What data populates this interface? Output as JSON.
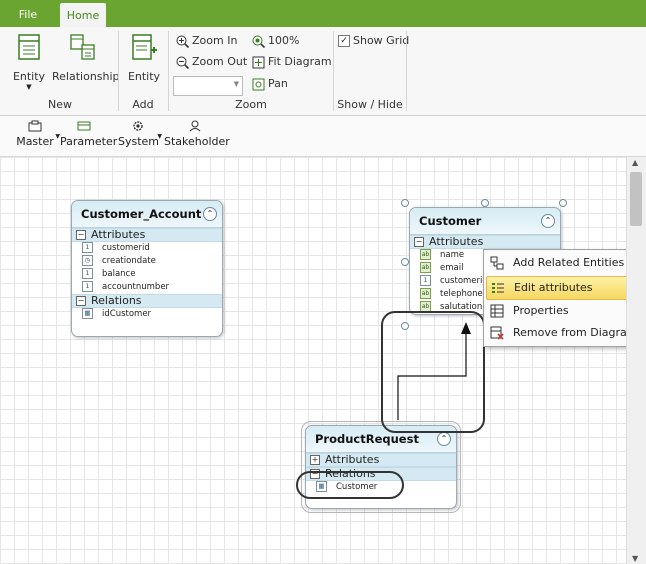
{
  "tabs": {
    "file": "File",
    "home": "Home"
  },
  "ribbon": {
    "new_group": {
      "name": "New",
      "entity_label": "Entity",
      "relationship_label": "Relationship"
    },
    "add_group": {
      "name": "Add",
      "entity_label": "Entity"
    },
    "zoom_group": {
      "name": "Zoom",
      "zoom_in": "Zoom In",
      "zoom_out": "Zoom Out",
      "zoom_100": "100%",
      "fit_diagram": "Fit Diagram",
      "pan": "Pan",
      "zoom_select_value": ""
    },
    "showhide_group": {
      "name": "Show / Hide",
      "show_grid_label": "Show Grid",
      "show_grid_checked": true
    }
  },
  "toolbar": {
    "master": "Master",
    "parameter": "Parameter",
    "system": "System",
    "stakeholder": "Stakeholder"
  },
  "entities": {
    "customer_account": {
      "title": "Customer_Account",
      "attributes_label": "Attributes",
      "attributes": [
        {
          "icon": "1",
          "name": "customerid"
        },
        {
          "icon": "clock",
          "name": "creationdate"
        },
        {
          "icon": "1",
          "name": "balance"
        },
        {
          "icon": "1",
          "name": "accountnumber"
        }
      ],
      "relations_label": "Relations",
      "relations": [
        {
          "name": "idCustomer"
        }
      ]
    },
    "customer": {
      "title": "Customer",
      "attributes_label": "Attributes",
      "attributes": [
        {
          "icon": "ab",
          "name": "name"
        },
        {
          "icon": "ab",
          "name": "email"
        },
        {
          "icon": "1",
          "name": "customerid"
        },
        {
          "icon": "ab",
          "name": "telephone"
        },
        {
          "icon": "ab",
          "name": "salutation"
        }
      ]
    },
    "product_request": {
      "title": "ProductRequest",
      "attributes_label": "Attributes",
      "relations_label": "Relations",
      "relations": [
        {
          "name": "Customer"
        }
      ]
    }
  },
  "context_menu": {
    "items": [
      {
        "label": "Add Related Entities",
        "icon": "related-entities-icon"
      },
      {
        "label": "Edit attributes",
        "icon": "edit-attributes-icon",
        "highlighted": true
      },
      {
        "label": "Properties",
        "icon": "properties-icon"
      },
      {
        "label": "Remove from Diagram",
        "icon": "remove-diagram-icon"
      }
    ]
  },
  "colors": {
    "accent": "#6aa531",
    "entity_header": "#d6ecf4",
    "highlight": "#f6d861"
  }
}
